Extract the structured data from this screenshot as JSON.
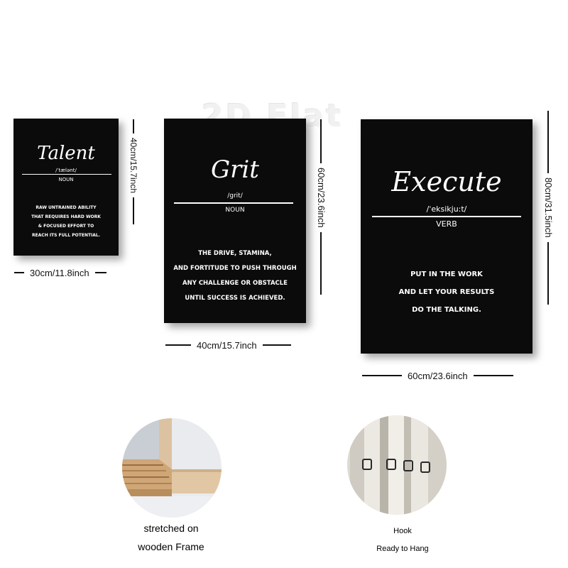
{
  "watermark": "2D Flat",
  "posters": [
    {
      "word": "Talent",
      "pronunciation": "/ˈtælənt/",
      "part_of_speech": "NOUN",
      "definition": [
        "RAW UNTRAINED ABILITY",
        "THAT REQUIRES HARD WORK",
        "& FOCUSED EFFORT TO",
        "REACH ITS FULL POTENTIAL."
      ],
      "width_label": "30cm/11.8inch",
      "height_label": "40cm/15.7inch"
    },
    {
      "word": "Grit",
      "pronunciation": "/grit/",
      "part_of_speech": "NOUN",
      "definition": [
        "THE DRIVE, STAMINA,",
        "AND FORTITUDE TO PUSH THROUGH",
        "ANY CHALLENGE OR OBSTACLE",
        "UNTIL SUCCESS IS ACHIEVED."
      ],
      "width_label": "40cm/15.7inch",
      "height_label": "60cm/23.6inch"
    },
    {
      "word": "Execute",
      "pronunciation": "/ˈeksikju:t/",
      "part_of_speech": "VERB",
      "definition": [
        "PUT IN THE WORK",
        "AND LET YOUR RESULTS",
        "DO THE TALKING."
      ],
      "width_label": "60cm/23.6inch",
      "height_label": "80cm/31.5inch"
    }
  ],
  "features": [
    {
      "caption": [
        "stretched on",
        "wooden Frame"
      ]
    },
    {
      "caption": [
        "Hook",
        "Ready to Hang"
      ]
    }
  ]
}
